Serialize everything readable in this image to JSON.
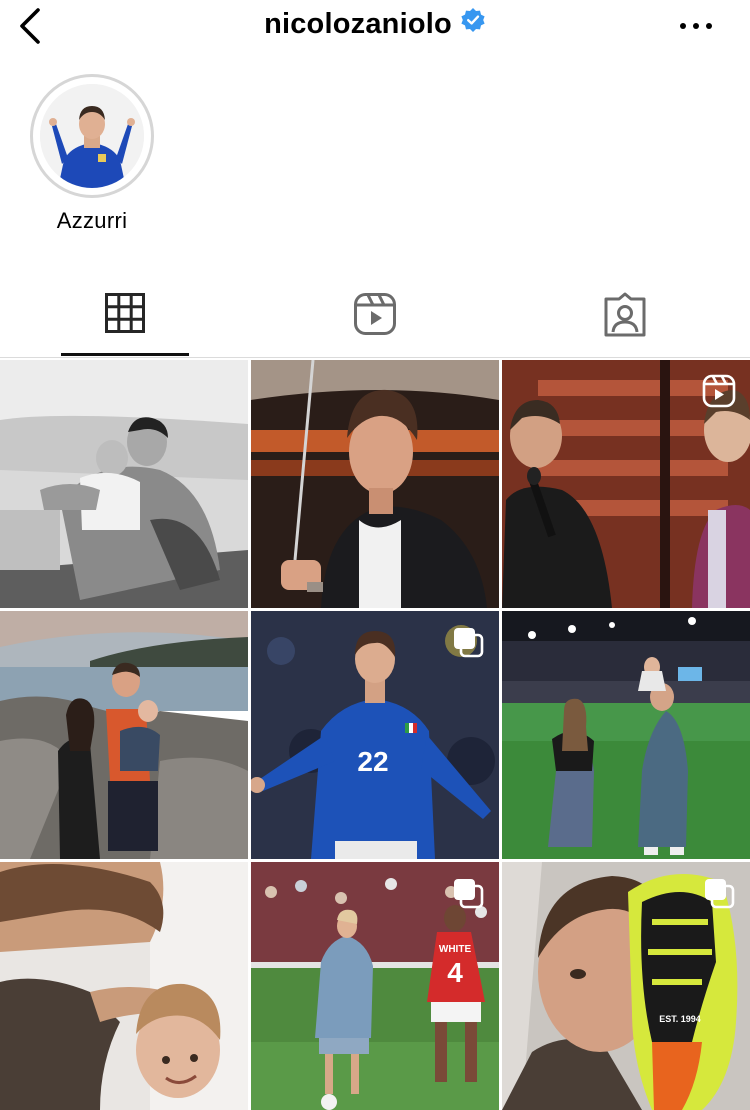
{
  "header": {
    "username": "nicolozaniolo",
    "verified": true,
    "back_icon": "chevron-left-icon",
    "more_icon": "ellipsis-icon"
  },
  "highlights": [
    {
      "label": "Azzurri"
    }
  ],
  "tabs": [
    {
      "name": "posts",
      "icon": "grid-icon",
      "selected": true
    },
    {
      "name": "reels",
      "icon": "reels-icon",
      "selected": false
    },
    {
      "name": "tagged",
      "icon": "tagged-person-icon",
      "selected": false
    }
  ],
  "posts": [
    {
      "type": "photo",
      "badge": null,
      "tone": "monochrome"
    },
    {
      "type": "photo",
      "badge": null,
      "tone": "warm"
    },
    {
      "type": "reel",
      "badge": "reel-icon",
      "tone": "stage"
    },
    {
      "type": "photo",
      "badge": null,
      "tone": "seaside"
    },
    {
      "type": "carousel",
      "badge": "carousel-icon",
      "tone": "blue-kit",
      "shirt_number": "22"
    },
    {
      "type": "photo",
      "badge": null,
      "tone": "stadium-night"
    },
    {
      "type": "photo",
      "badge": null,
      "tone": "indoor"
    },
    {
      "type": "carousel",
      "badge": "carousel-icon",
      "tone": "match",
      "shirt_number": "4",
      "shirt_name": "WHITE"
    },
    {
      "type": "carousel",
      "badge": "carousel-icon",
      "tone": "boot-portrait",
      "boot_text": "EST. 1994"
    }
  ],
  "colors": {
    "verified": "#3797f0",
    "text": "#000000",
    "divider": "#dbdbdb"
  }
}
